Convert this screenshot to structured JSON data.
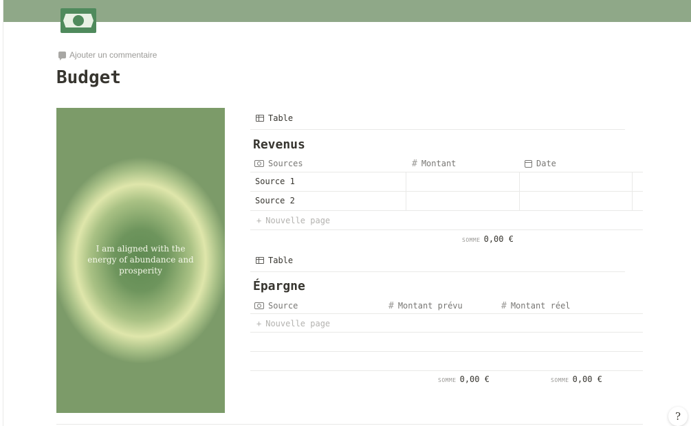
{
  "page": {
    "comment_label": "Ajouter un commentaire",
    "title": "Budget",
    "cover_color": "#8fa888",
    "icon": "money-bill-icon"
  },
  "quote": {
    "lines": [
      "I am aligned with the",
      "energy of abundance and",
      "prosperity"
    ]
  },
  "revenus": {
    "view_label": "Table",
    "title": "Revenus",
    "columns": [
      {
        "label": "Sources",
        "icon": "money-icon"
      },
      {
        "label": "Montant",
        "icon": "hash-icon"
      },
      {
        "label": "Date",
        "icon": "calendar-icon"
      }
    ],
    "rows": [
      {
        "source": "Source 1",
        "montant": "",
        "date": ""
      },
      {
        "source": "Source 2",
        "montant": "",
        "date": ""
      }
    ],
    "new_page_label": "Nouvelle page",
    "sum": {
      "label": "SOMME",
      "value": "0,00 €"
    }
  },
  "epargne": {
    "view_label": "Table",
    "title": "Épargne",
    "columns": [
      {
        "label": "Source",
        "icon": "money-icon"
      },
      {
        "label": "Montant prévu",
        "icon": "hash-icon"
      },
      {
        "label": "Montant réel",
        "icon": "hash-icon"
      }
    ],
    "new_page_label": "Nouvelle page",
    "sums": [
      {
        "label": "SOMME",
        "value": "0,00 €"
      },
      {
        "label": "SOMME",
        "value": "0,00 €"
      }
    ]
  },
  "help": {
    "label": "?"
  },
  "colors": {
    "accent_green": "#4f8a5c",
    "text": "#37352f",
    "muted": "#9b9a97"
  }
}
